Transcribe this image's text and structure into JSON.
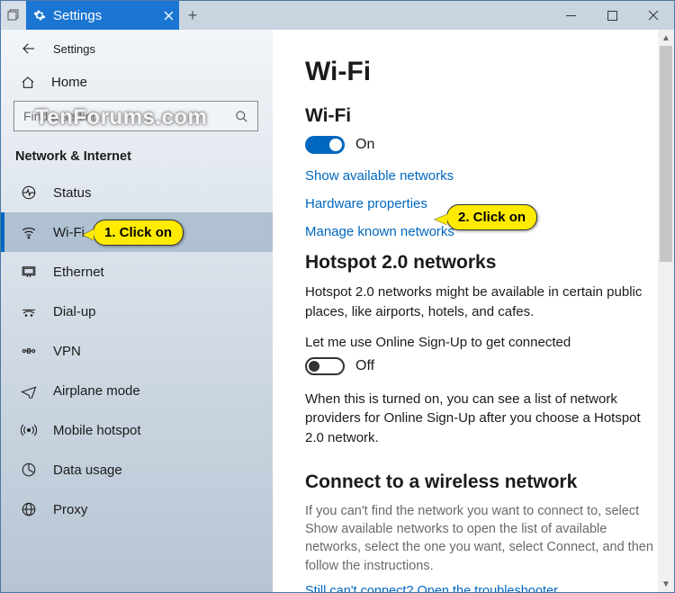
{
  "tab": {
    "title": "Settings"
  },
  "header": {
    "breadcrumb": "Settings"
  },
  "watermark": "TenForums.com",
  "sidebar": {
    "home": "Home",
    "search_placeholder": "Find a setting",
    "category": "Network & Internet",
    "items": [
      {
        "icon": "status-icon",
        "label": "Status"
      },
      {
        "icon": "wifi-icon",
        "label": "Wi-Fi",
        "selected": true
      },
      {
        "icon": "ethernet-icon",
        "label": "Ethernet"
      },
      {
        "icon": "dialup-icon",
        "label": "Dial-up"
      },
      {
        "icon": "vpn-icon",
        "label": "VPN"
      },
      {
        "icon": "airplane-icon",
        "label": "Airplane mode"
      },
      {
        "icon": "hotspot-icon",
        "label": "Mobile hotspot"
      },
      {
        "icon": "datausage-icon",
        "label": "Data usage"
      },
      {
        "icon": "proxy-icon",
        "label": "Proxy"
      }
    ]
  },
  "main": {
    "title": "Wi-Fi",
    "wifi_heading": "Wi-Fi",
    "wifi_toggle_state": "On",
    "links": {
      "show_networks": "Show available networks",
      "hardware": "Hardware properties",
      "manage_known": "Manage known networks"
    },
    "hotspot": {
      "heading": "Hotspot 2.0 networks",
      "desc": "Hotspot 2.0 networks might be available in certain public places, like airports, hotels, and cafes.",
      "toggle_label": "Let me use Online Sign-Up to get connected",
      "toggle_state": "Off",
      "note": "When this is turned on, you can see a list of network providers for Online Sign-Up after you choose a Hotspot 2.0 network."
    },
    "connect": {
      "heading": "Connect to a wireless network",
      "help": "If you can't find the network you want to connect to, select Show available networks to open the list of available networks, select the one you want, select Connect, and then follow the instructions.",
      "troubleshoot": "Still can't connect? Open the troubleshooter"
    }
  },
  "callouts": {
    "c1": "1. Click on",
    "c2": "2. Click on"
  }
}
